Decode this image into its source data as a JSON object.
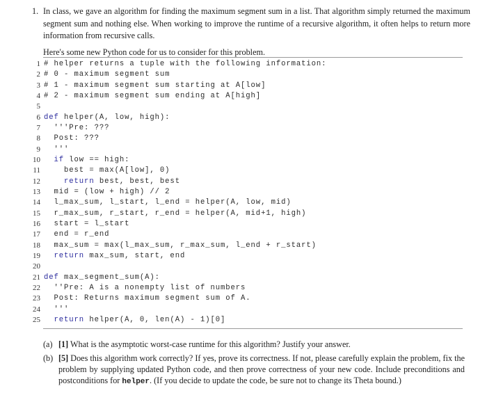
{
  "problem": {
    "number": "1.",
    "intro": "In class, we gave an algorithm for finding the maximum segment sum in a list. That algorithm simply returned the maximum segment sum and nothing else. When working to improve the runtime of a recursive algorithm, it often helps to return more information from recursive calls.",
    "lead": "Here's some new Python code for us to consider for this problem."
  },
  "code": {
    "language": "Python",
    "keyword_color": "#2c2c9e",
    "lines": [
      {
        "n": "1",
        "kw": "",
        "pre": "",
        "text": "# helper returns a tuple with the following information:"
      },
      {
        "n": "2",
        "kw": "",
        "pre": "",
        "text": "# 0 - maximum segment sum"
      },
      {
        "n": "3",
        "kw": "",
        "pre": "",
        "text": "# 1 - maximum segment sum starting at A[low]"
      },
      {
        "n": "4",
        "kw": "",
        "pre": "",
        "text": "# 2 - maximum segment sum ending at A[high]"
      },
      {
        "n": "5",
        "kw": "",
        "pre": "",
        "text": ""
      },
      {
        "n": "6",
        "kw": "def",
        "pre": "",
        "text": " helper(A, low, high):"
      },
      {
        "n": "7",
        "kw": "",
        "pre": "  ",
        "text": "'''Pre: ???"
      },
      {
        "n": "8",
        "kw": "",
        "pre": "  ",
        "text": "Post: ???"
      },
      {
        "n": "9",
        "kw": "",
        "pre": "  ",
        "text": "'''"
      },
      {
        "n": "10",
        "kw": "if",
        "pre": "  ",
        "text": " low == high:"
      },
      {
        "n": "11",
        "kw": "",
        "pre": "    ",
        "text": "best = max(A[low], 0)"
      },
      {
        "n": "12",
        "kw": "return",
        "pre": "    ",
        "text": " best, best, best"
      },
      {
        "n": "13",
        "kw": "",
        "pre": "  ",
        "text": "mid = (low + high) // 2"
      },
      {
        "n": "14",
        "kw": "",
        "pre": "  ",
        "text": "l_max_sum, l_start, l_end = helper(A, low, mid)"
      },
      {
        "n": "15",
        "kw": "",
        "pre": "  ",
        "text": "r_max_sum, r_start, r_end = helper(A, mid+1, high)"
      },
      {
        "n": "16",
        "kw": "",
        "pre": "  ",
        "text": "start = l_start"
      },
      {
        "n": "17",
        "kw": "",
        "pre": "  ",
        "text": "end = r_end"
      },
      {
        "n": "18",
        "kw": "",
        "pre": "  ",
        "text": "max_sum = max(l_max_sum, r_max_sum, l_end + r_start)"
      },
      {
        "n": "19",
        "kw": "return",
        "pre": "  ",
        "text": " max_sum, start, end"
      },
      {
        "n": "20",
        "kw": "",
        "pre": "",
        "text": ""
      },
      {
        "n": "21",
        "kw": "def",
        "pre": "",
        "text": " max_segment_sum(A):"
      },
      {
        "n": "22",
        "kw": "",
        "pre": "  ",
        "text": "''Pre: A is a nonempty list of numbers"
      },
      {
        "n": "23",
        "kw": "",
        "pre": "  ",
        "text": "Post: Returns maximum segment sum of A."
      },
      {
        "n": "24",
        "kw": "",
        "pre": "  ",
        "text": "'''"
      },
      {
        "n": "25",
        "kw": "return",
        "pre": "  ",
        "text": " helper(A, 0, len(A) - 1)[0]"
      }
    ]
  },
  "parts": [
    {
      "label": "(a)",
      "points": "[1]",
      "text_before": " What is the asymptotic worst-case runtime for this algorithm? Justify your answer.",
      "code_word": "",
      "text_after": ""
    },
    {
      "label": "(b)",
      "points": "[5]",
      "text_before": " Does this algorithm work correctly? If yes, prove its correctness. If not, please carefully explain the problem, fix the problem by supplying updated Python code, and then prove correctness of your new code. Include preconditions and postconditions for ",
      "code_word": "helper",
      "text_after": ". (If you decide to update the code, be sure not to change its Theta bound.)"
    }
  ]
}
